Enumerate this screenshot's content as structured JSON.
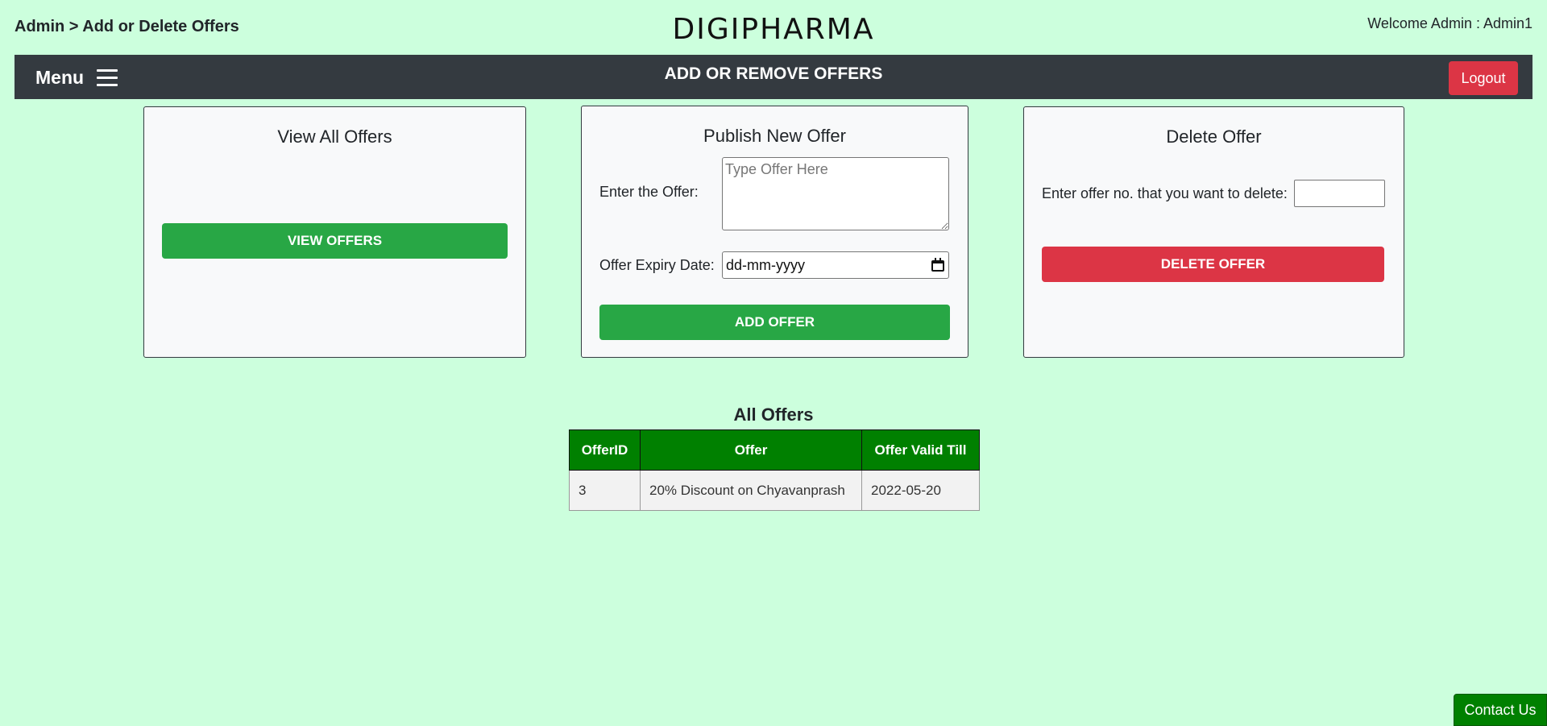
{
  "header": {
    "breadcrumb": "Admin > Add or Delete Offers",
    "brand": "DIGIPHARMA",
    "welcome": "Welcome Admin : Admin1"
  },
  "navbar": {
    "menu_label": "Menu",
    "menu_icon": "hamburger-icon",
    "title": "ADD OR REMOVE OFFERS",
    "logout_label": "Logout"
  },
  "cards": {
    "view": {
      "title": "View All Offers",
      "button_label": "VIEW OFFERS"
    },
    "publish": {
      "title": "Publish New Offer",
      "offer_label": "Enter the Offer:",
      "offer_placeholder": "Type Offer Here",
      "expiry_label": "Offer Expiry Date:",
      "expiry_value": "dd-mm-yyyy",
      "calendar_icon": "calendar-icon",
      "button_label": "ADD OFFER"
    },
    "delete": {
      "title": "Delete Offer",
      "label": "Enter offer no. that you want to delete:",
      "input_value": "",
      "button_label": "DELETE OFFER"
    }
  },
  "offers_table": {
    "caption": "All Offers",
    "headers": [
      "OfferID",
      "Offer",
      "Offer Valid Till"
    ],
    "rows": [
      [
        "3",
        "20% Discount on Chyavanprash",
        "2022-05-20"
      ]
    ]
  },
  "footer": {
    "contact_label": "Contact Us"
  },
  "colors": {
    "page_background": "#ccffdd",
    "navbar": "#343a40",
    "success": "#28a745",
    "danger": "#dc3545",
    "table_header": "#008000"
  }
}
